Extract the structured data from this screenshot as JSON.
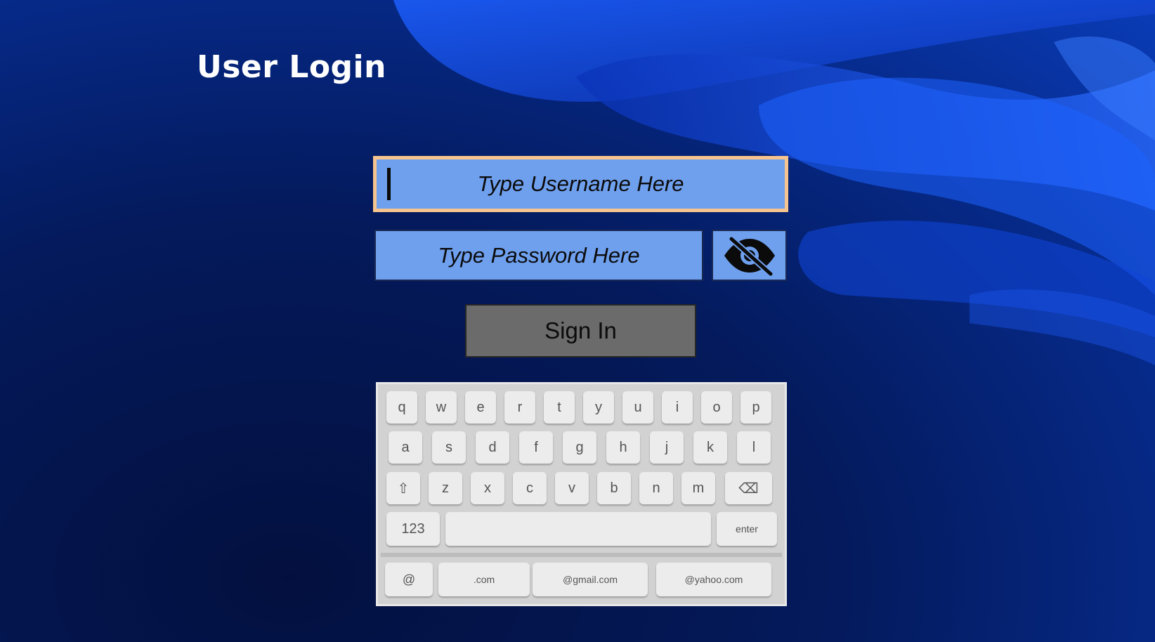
{
  "page": {
    "title": "User Login"
  },
  "form": {
    "username_placeholder": "Type Username Here",
    "password_placeholder": "Type Password Here",
    "signin_label": "Sign In",
    "toggle_icon": "eye-slash-icon"
  },
  "keyboard": {
    "row1": [
      "q",
      "w",
      "e",
      "r",
      "t",
      "y",
      "u",
      "i",
      "o",
      "p"
    ],
    "row2": [
      "a",
      "s",
      "d",
      "f",
      "g",
      "h",
      "j",
      "k",
      "l"
    ],
    "row3": [
      "⇧",
      "z",
      "x",
      "c",
      "v",
      "b",
      "n",
      "m",
      "⌫"
    ],
    "numbers_key": "123",
    "enter_key": "enter",
    "suggestions": [
      "@",
      ".com",
      "@gmail.com",
      "@yahoo.com"
    ]
  },
  "colors": {
    "field_bg": "#6fa0ee",
    "focus_border": "#f6c48e",
    "button_bg": "#6b6b6b"
  }
}
